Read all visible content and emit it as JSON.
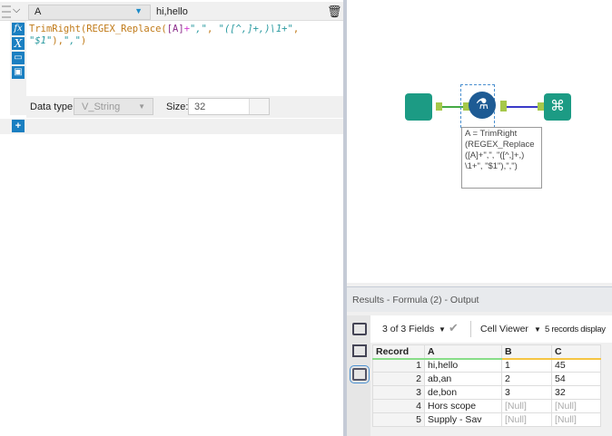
{
  "formula": {
    "field": "A",
    "preview": "hi,hello",
    "code": {
      "l1_fn": "TrimRight(REGEX_Replace(",
      "l1_field": "[A]",
      "l1_op": "+",
      "l1_s1": "\",\"",
      "l1_sep": ", ",
      "l1_s2": "\"([^,]+,)\\1+\"",
      "l1_end": ",",
      "l2_s3": "\"$1\"",
      "l2_mid": "),",
      "l2_s4": "\",\"",
      "l2_end": ")"
    },
    "data_type_label": "Data type:",
    "data_type": "V_String",
    "size_label": "Size:",
    "size": "32"
  },
  "canvas": {
    "annotation": "A = TrimRight (REGEX_Replace ([A]+\",\", \"([^,]+,) \\1+\", \"$1\"),\",\")"
  },
  "results": {
    "title": "Results - Formula (2) - Output",
    "fields": "3 of 3 Fields",
    "viewer": "Cell Viewer",
    "records": "5 records display",
    "columns": [
      "Record",
      "A",
      "B",
      "C"
    ],
    "rows": [
      [
        "1",
        "hi,hello",
        "1",
        "45"
      ],
      [
        "2",
        "ab,an",
        "2",
        "54"
      ],
      [
        "3",
        "de,bon",
        "3",
        "32"
      ],
      [
        "4",
        "Hors scope",
        "[Null]",
        "[Null]"
      ],
      [
        "5",
        "Supply - Sav",
        "[Null]",
        "[Null]"
      ]
    ]
  }
}
